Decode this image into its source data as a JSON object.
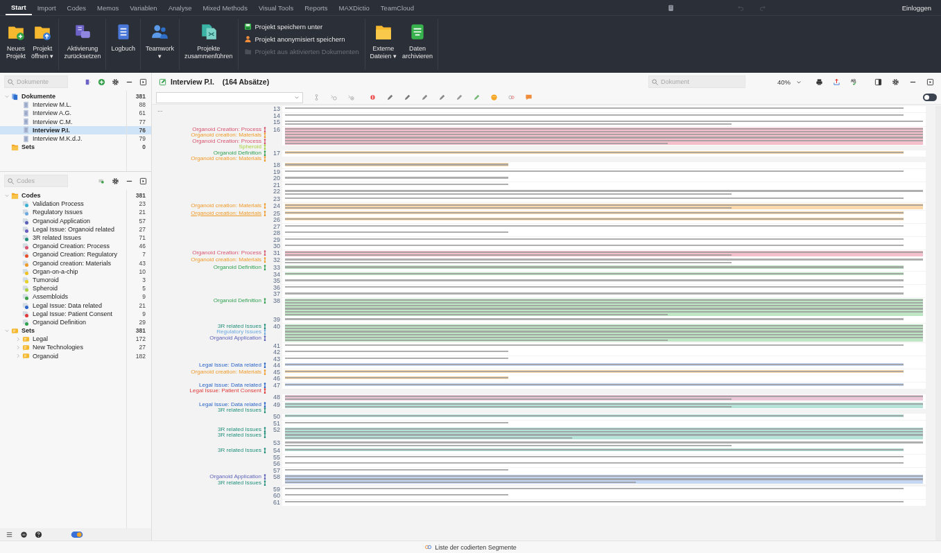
{
  "menu_bar": {
    "tabs": [
      {
        "label": "Start",
        "selected": true
      },
      {
        "label": "Import",
        "selected": false
      },
      {
        "label": "Codes",
        "selected": false
      },
      {
        "label": "Memos",
        "selected": false
      },
      {
        "label": "Variablen",
        "selected": false
      },
      {
        "label": "Analyse",
        "selected": false
      },
      {
        "label": "Mixed Methods",
        "selected": false
      },
      {
        "label": "Visual Tools",
        "selected": false
      },
      {
        "label": "Reports",
        "selected": false
      },
      {
        "label": "MAXDictio",
        "selected": false
      },
      {
        "label": "TeamCloud",
        "selected": false
      }
    ],
    "login": "Einloggen"
  },
  "ribbon": {
    "groups": [
      {
        "kind": "large",
        "buttons": [
          {
            "lines": [
              "Neues",
              "Projekt"
            ]
          },
          {
            "lines": [
              "Projekt",
              "öffnen ▾"
            ]
          }
        ]
      },
      {
        "kind": "large",
        "buttons": [
          {
            "lines": [
              "Aktivierung",
              "zurücksetzen"
            ]
          }
        ]
      },
      {
        "kind": "large",
        "buttons": [
          {
            "lines": [
              "Logbuch"
            ]
          }
        ]
      },
      {
        "kind": "large",
        "buttons": [
          {
            "lines": [
              "Teamwork",
              "▾"
            ]
          }
        ]
      },
      {
        "kind": "large",
        "buttons": [
          {
            "lines": [
              "Projekte",
              "zusammenführen"
            ]
          }
        ]
      },
      {
        "kind": "small",
        "buttons": [
          {
            "lines": [
              "Projekt speichern unter"
            ],
            "disabled": false
          },
          {
            "lines": [
              "Projekt anonymisiert speichern"
            ],
            "disabled": false
          },
          {
            "lines": [
              "Projekt aus aktivierten Dokumenten"
            ],
            "disabled": true
          }
        ]
      },
      {
        "kind": "large",
        "buttons": [
          {
            "lines": [
              "Externe",
              "Dateien ▾"
            ]
          },
          {
            "lines": [
              "Daten",
              "archivieren"
            ]
          }
        ]
      }
    ]
  },
  "document_system": {
    "search": {
      "placeholder": "Dokumente"
    },
    "tree": [
      {
        "label": "Dokumente",
        "count": "381",
        "kind": "docroot",
        "expanded": true,
        "selected": false,
        "children": [
          {
            "label": "Interview M.L.",
            "count": "88",
            "kind": "doc",
            "selected": false
          },
          {
            "label": "Interview A.G.",
            "count": "61",
            "kind": "doc",
            "selected": false
          },
          {
            "label": "Interview C.M.",
            "count": "77",
            "kind": "doc",
            "selected": false
          },
          {
            "label": "Interview P.I.",
            "count": "76",
            "kind": "doc",
            "selected": true
          },
          {
            "label": "Interview M.K.d.J.",
            "count": "79",
            "kind": "doc",
            "selected": false
          }
        ]
      },
      {
        "label": "Sets",
        "count": "0",
        "kind": "docsets",
        "selected": false
      }
    ]
  },
  "code_system": {
    "search": {
      "placeholder": "Codes"
    },
    "tree": [
      {
        "label": "Codes",
        "count": "381",
        "kind": "coderoot",
        "expanded": true,
        "children": [
          {
            "label": "Validation Process",
            "count": "23",
            "kind": "code",
            "color": "#3ab0d4"
          },
          {
            "label": "Regulatory Issues",
            "count": "21",
            "kind": "code",
            "color": "#6aa8e0"
          },
          {
            "label": "Organoid Application",
            "count": "57",
            "kind": "code",
            "color": "#5a5fb8"
          },
          {
            "label": "Legal Issue: Organoid related",
            "count": "27",
            "kind": "code",
            "color": "#6a5cc0"
          },
          {
            "label": "3R related Issues",
            "count": "71",
            "kind": "code",
            "color": "#1f8f7a"
          },
          {
            "label": "Organoid Creation: Process",
            "count": "46",
            "kind": "code",
            "color": "#d9546e"
          },
          {
            "label": "Organoid Creation: Regulatory",
            "count": "7",
            "kind": "code",
            "color": "#e8502c"
          },
          {
            "label": "Organoid creation: Materials",
            "count": "43",
            "kind": "code",
            "color": "#f09a28"
          },
          {
            "label": "Organ-on-a-chip",
            "count": "10",
            "kind": "code",
            "color": "#f0c020"
          },
          {
            "label": "Tumoroid",
            "count": "3",
            "kind": "code",
            "color": "#e6d020"
          },
          {
            "label": "Spheroid",
            "count": "5",
            "kind": "code",
            "color": "#a8d040"
          },
          {
            "label": "Assembloids",
            "count": "9",
            "kind": "code",
            "color": "#3aa048"
          },
          {
            "label": "Legal Issue: Data related",
            "count": "21",
            "kind": "code",
            "color": "#2a64c8"
          },
          {
            "label": "Legal Issue: Patient Consent",
            "count": "9",
            "kind": "code",
            "color": "#e03838"
          },
          {
            "label": "Organoid Definition",
            "count": "29",
            "kind": "code",
            "color": "#2fa050"
          }
        ]
      },
      {
        "label": "Sets",
        "count": "381",
        "kind": "setroot",
        "expanded": true,
        "children": [
          {
            "label": "Legal",
            "count": "172",
            "kind": "set",
            "expanded": false
          },
          {
            "label": "New Technologies",
            "count": "27",
            "kind": "set",
            "expanded": false
          },
          {
            "label": "Organoid",
            "count": "182",
            "kind": "set",
            "expanded": false
          }
        ]
      }
    ]
  },
  "document_browser": {
    "title": "Interview P.I.",
    "subtitle": "(164 Absätze)",
    "search": {
      "placeholder": "Dokument"
    },
    "zoom": "40%",
    "margin_more": "...",
    "edit_mode": {
      "on": false
    },
    "paragraphs": [
      {
        "number": "13",
        "kind": "line"
      },
      {
        "number": "14",
        "kind": "line"
      },
      {
        "number": "15",
        "kind": "two"
      },
      {
        "number": "16",
        "kind": "block",
        "color": "#f3bfcb",
        "codes": [
          {
            "label": "Organoid Creation: Process",
            "color": "#d9546e",
            "selected": false
          },
          {
            "label": "Organoid creation: Materials",
            "color": "#f09a28",
            "selected": false
          },
          {
            "label": "Organoid Creation: Process",
            "color": "#d9546e",
            "selected": false
          },
          {
            "label": "Spheroid",
            "color": "#a8d040",
            "selected": false
          }
        ]
      },
      {
        "number": "17",
        "kind": "line",
        "color": "#fbd9ab",
        "codes": [
          {
            "label": "Organoid Definition",
            "color": "#2fa050",
            "selected": false
          },
          {
            "label": "Organoid creation: Materials",
            "color": "#f09a28",
            "selected": false
          }
        ]
      },
      {
        "number": "18",
        "kind": "short",
        "color": "#fbd9ab"
      },
      {
        "number": "19",
        "kind": "line"
      },
      {
        "number": "20",
        "kind": "short"
      },
      {
        "number": "21",
        "kind": "short"
      },
      {
        "number": "22",
        "kind": "two"
      },
      {
        "number": "23",
        "kind": "line"
      },
      {
        "number": "24",
        "kind": "two",
        "color": "#fbd9ab",
        "codes": [
          {
            "label": "Organoid creation: Materials",
            "color": "#f09a28",
            "selected": false
          }
        ]
      },
      {
        "number": "25",
        "kind": "line",
        "color": "#fbd9ab",
        "codes": [
          {
            "label": "Organoid creation: Materials",
            "color": "#f09a28",
            "selected": true
          }
        ]
      },
      {
        "number": "26",
        "kind": "line",
        "color": "#fbd9ab"
      },
      {
        "number": "27",
        "kind": "line"
      },
      {
        "number": "28",
        "kind": "short"
      },
      {
        "number": "29",
        "kind": "line"
      },
      {
        "number": "30",
        "kind": "line"
      },
      {
        "number": "31",
        "kind": "two",
        "color": "#f3bfcb",
        "codes": [
          {
            "label": "Organoid Creation: Process",
            "color": "#d9546e",
            "selected": false
          }
        ]
      },
      {
        "number": "32",
        "kind": "two",
        "codes": [
          {
            "label": "Organoid creation: Materials",
            "color": "#f09a28",
            "selected": false
          }
        ]
      },
      {
        "number": "33",
        "kind": "line",
        "color": "#bfe6c4",
        "codes": [
          {
            "label": "Organoid Definition",
            "color": "#2fa050",
            "selected": false
          }
        ]
      },
      {
        "number": "34",
        "kind": "line",
        "color": "#bfe6c4"
      },
      {
        "number": "35",
        "kind": "line"
      },
      {
        "number": "36",
        "kind": "line"
      },
      {
        "number": "37",
        "kind": "line"
      },
      {
        "number": "38",
        "kind": "block",
        "color": "#bfe6c4",
        "codes": [
          {
            "label": "Organoid Definition",
            "color": "#2fa050",
            "selected": false
          }
        ]
      },
      {
        "number": "39",
        "kind": "line"
      },
      {
        "number": "40",
        "kind": "block",
        "color": "#bfe6c4",
        "codes": [
          {
            "label": "3R related Issues",
            "color": "#1f8f7a",
            "selected": false
          },
          {
            "label": "Regulatory Issues",
            "color": "#6aa8e0",
            "selected": false
          },
          {
            "label": "Organoid Application",
            "color": "#5a5fb8",
            "selected": false
          }
        ]
      },
      {
        "number": "41",
        "kind": "line"
      },
      {
        "number": "42",
        "kind": "short"
      },
      {
        "number": "43",
        "kind": "short"
      },
      {
        "number": "44",
        "kind": "line",
        "color": "#c4d6f2",
        "codes": [
          {
            "label": "Legal Issue: Data related",
            "color": "#2a64c8",
            "selected": false
          }
        ]
      },
      {
        "number": "45",
        "kind": "line",
        "color": "#fbd9ab",
        "codes": [
          {
            "label": "Organoid creation: Materials",
            "color": "#f09a28",
            "selected": false
          }
        ]
      },
      {
        "number": "46",
        "kind": "short",
        "color": "#fbd9ab"
      },
      {
        "number": "47",
        "kind": "line",
        "color": "#c4d6f2",
        "codes": [
          {
            "label": "Legal Issue: Data related",
            "color": "#2a64c8",
            "selected": false
          },
          {
            "label": "Legal Issue: Patient Consent",
            "color": "#e03838",
            "selected": false
          }
        ]
      },
      {
        "number": "48",
        "kind": "two",
        "color": "#eac6d6"
      },
      {
        "number": "49",
        "kind": "two",
        "color": "#b6e2d8",
        "codes": [
          {
            "label": "Legal Issue: Data related",
            "color": "#2a64c8",
            "selected": false
          },
          {
            "label": "3R related Issues",
            "color": "#1f8f7a",
            "selected": false
          }
        ]
      },
      {
        "number": "50",
        "kind": "line",
        "color": "#b6e2d8"
      },
      {
        "number": "51",
        "kind": "short"
      },
      {
        "number": "52",
        "kind": "four",
        "color": "#b6e2d8",
        "codes": [
          {
            "label": "3R related Issues",
            "color": "#1f8f7a",
            "selected": false
          },
          {
            "label": "3R related Issues",
            "color": "#1f8f7a",
            "selected": false
          }
        ]
      },
      {
        "number": "53",
        "kind": "two"
      },
      {
        "number": "54",
        "kind": "line",
        "color": "#b6e2d8",
        "codes": [
          {
            "label": "3R related Issues",
            "color": "#1f8f7a",
            "selected": false
          }
        ]
      },
      {
        "number": "55",
        "kind": "line"
      },
      {
        "number": "56",
        "kind": "line"
      },
      {
        "number": "57",
        "kind": "short"
      },
      {
        "number": "58",
        "kind": "three",
        "color": "#c4d6f2",
        "codes": [
          {
            "label": "Organoid Application",
            "color": "#5a5fb8",
            "selected": false
          },
          {
            "label": "3R related Issues",
            "color": "#1f8f7a",
            "selected": false
          }
        ]
      },
      {
        "number": "59",
        "kind": "line"
      },
      {
        "number": "60",
        "kind": "short"
      },
      {
        "number": "61",
        "kind": "line"
      }
    ]
  },
  "status_bar": {
    "segments_label": "Liste der codierten Segmente"
  }
}
